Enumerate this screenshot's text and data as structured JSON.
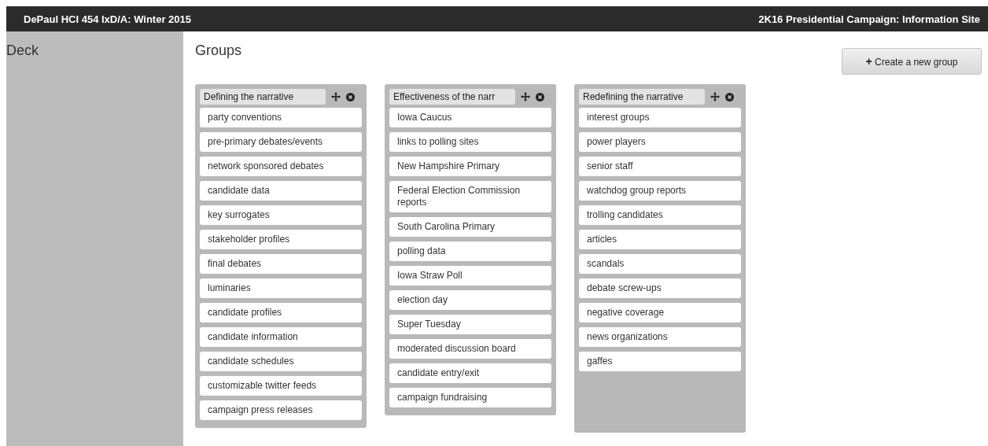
{
  "header": {
    "left": "DePaul HCI 454 IxD/A: Winter 2015",
    "right": "2K16 Presidential Campaign: Information Site"
  },
  "sidebar": {
    "title": "Deck"
  },
  "main": {
    "title": "Groups",
    "create_button": {
      "icon": "+",
      "label": "Create a new group"
    }
  },
  "groups": [
    {
      "name": "Defining the narrative",
      "cards": [
        "party conventions",
        "pre-primary debates/events",
        "network sponsored debates",
        "candidate data",
        "key surrogates",
        "stakeholder profiles",
        "final debates",
        "luminaries",
        "candidate profiles",
        "candidate information",
        "candidate schedules",
        "customizable twitter feeds",
        "campaign press releases"
      ]
    },
    {
      "name": "Effectiveness of the narr",
      "cards": [
        "Iowa Caucus",
        "links to polling sites",
        "New Hampshire Primary",
        "Federal Election Commission reports",
        "South Carolina Primary",
        "polling data",
        "Iowa Straw Poll",
        "election day",
        "Super Tuesday",
        "moderated discussion board",
        "candidate entry/exit",
        "campaign fundraising"
      ]
    },
    {
      "name": "Redefining the narrative",
      "cards": [
        "interest groups",
        "power players",
        "senior staff",
        "watchdog group reports",
        "trolling candidates",
        "articles",
        "scandals",
        "debate screw-ups",
        "negative coverage",
        "news organizations",
        "gaffes"
      ]
    }
  ]
}
